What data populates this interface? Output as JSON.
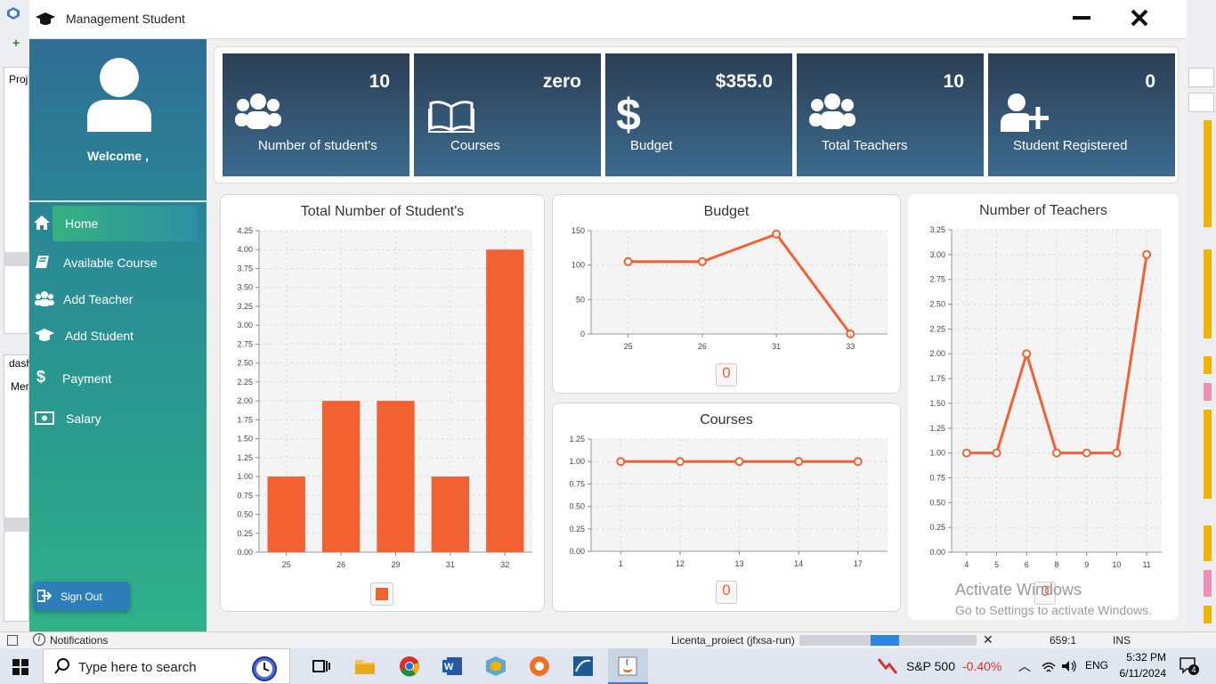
{
  "window": {
    "title": "Management Student"
  },
  "ide": {
    "left_tab_1": "Proj",
    "left_tab_2": "dash",
    "left_tab_3": "Mer"
  },
  "sidebar": {
    "welcome": "Welcome ,",
    "items": [
      {
        "label": "Home",
        "icon": "home-icon",
        "active": true
      },
      {
        "label": "Available Course",
        "icon": "book-icon"
      },
      {
        "label": "Add Teacher",
        "icon": "users-icon"
      },
      {
        "label": "Add Student",
        "icon": "graduation-cap-icon"
      },
      {
        "label": "Payment",
        "icon": "dollar-icon"
      },
      {
        "label": "Salary",
        "icon": "money-bill-icon"
      }
    ],
    "signout": "Sign Out"
  },
  "cards": [
    {
      "value": "10",
      "label": "Number of student's",
      "icon": "users-icon"
    },
    {
      "value": "zero",
      "label": "Courses",
      "icon": "open-book-icon"
    },
    {
      "value": "$355.0",
      "label": "Budget",
      "icon": "dollar-icon"
    },
    {
      "value": "10",
      "label": "Total Teachers",
      "icon": "users-icon"
    },
    {
      "value": "0",
      "label": "Student Registered",
      "icon": "user-plus-icon"
    }
  ],
  "chart_data": [
    {
      "type": "bar",
      "title": "Total Number of Student's",
      "categories": [
        "25",
        "26",
        "29",
        "31",
        "32"
      ],
      "values": [
        1,
        2,
        2,
        1,
        4
      ],
      "ylim": [
        0,
        4.25
      ],
      "yticks": [
        "0.00",
        "0.25",
        "0.50",
        "0.75",
        "1.00",
        "1.25",
        "1.50",
        "1.75",
        "2.00",
        "2.25",
        "2.50",
        "2.75",
        "3.00",
        "3.25",
        "3.50",
        "3.75",
        "4.00",
        "4.25"
      ],
      "color": "#f26132",
      "grid": true
    },
    {
      "type": "line",
      "title": "Budget",
      "categories": [
        "25",
        "26",
        "31",
        "33"
      ],
      "values": [
        105,
        105,
        145,
        0
      ],
      "ylim": [
        0,
        150
      ],
      "yticks": [
        "0",
        "50",
        "100",
        "150"
      ],
      "legend": "0",
      "color": "#f26132",
      "grid": true
    },
    {
      "type": "line",
      "title": "Courses",
      "categories": [
        "1",
        "12",
        "13",
        "14",
        "17"
      ],
      "values": [
        1,
        1,
        1,
        1,
        1
      ],
      "ylim": [
        0,
        1.25
      ],
      "yticks": [
        "0.00",
        "0.25",
        "0.50",
        "0.75",
        "1.00",
        "1.25"
      ],
      "legend": "0",
      "color": "#f26132",
      "grid": true
    },
    {
      "type": "line",
      "title": "Number of Teachers",
      "categories": [
        "4",
        "5",
        "6",
        "8",
        "9",
        "10",
        "11"
      ],
      "values": [
        1,
        1,
        2,
        1,
        1,
        1,
        3
      ],
      "ylim": [
        0,
        3.25
      ],
      "yticks": [
        "0.00",
        "0.25",
        "0.50",
        "0.75",
        "1.00",
        "1.25",
        "1.50",
        "1.75",
        "2.00",
        "2.25",
        "2.50",
        "2.75",
        "3.00",
        "3.25"
      ],
      "legend": "0",
      "color": "#f26132",
      "grid": true
    }
  ],
  "watermark": {
    "line1": "Activate Windows",
    "line2": "Go to Settings to activate Windows."
  },
  "statusbar": {
    "notifications": "Notifications",
    "project": "Licenta_proiect (jfxsa-run)",
    "progress": 0.4,
    "position": "659:1",
    "mode": "INS"
  },
  "taskbar": {
    "search_placeholder": "Type here to search",
    "stock_name": "S&P 500",
    "stock_change": "-0.40%",
    "lang": "ENG",
    "time": "5:32 PM",
    "date": "6/11/2024",
    "notif_count": "4"
  }
}
